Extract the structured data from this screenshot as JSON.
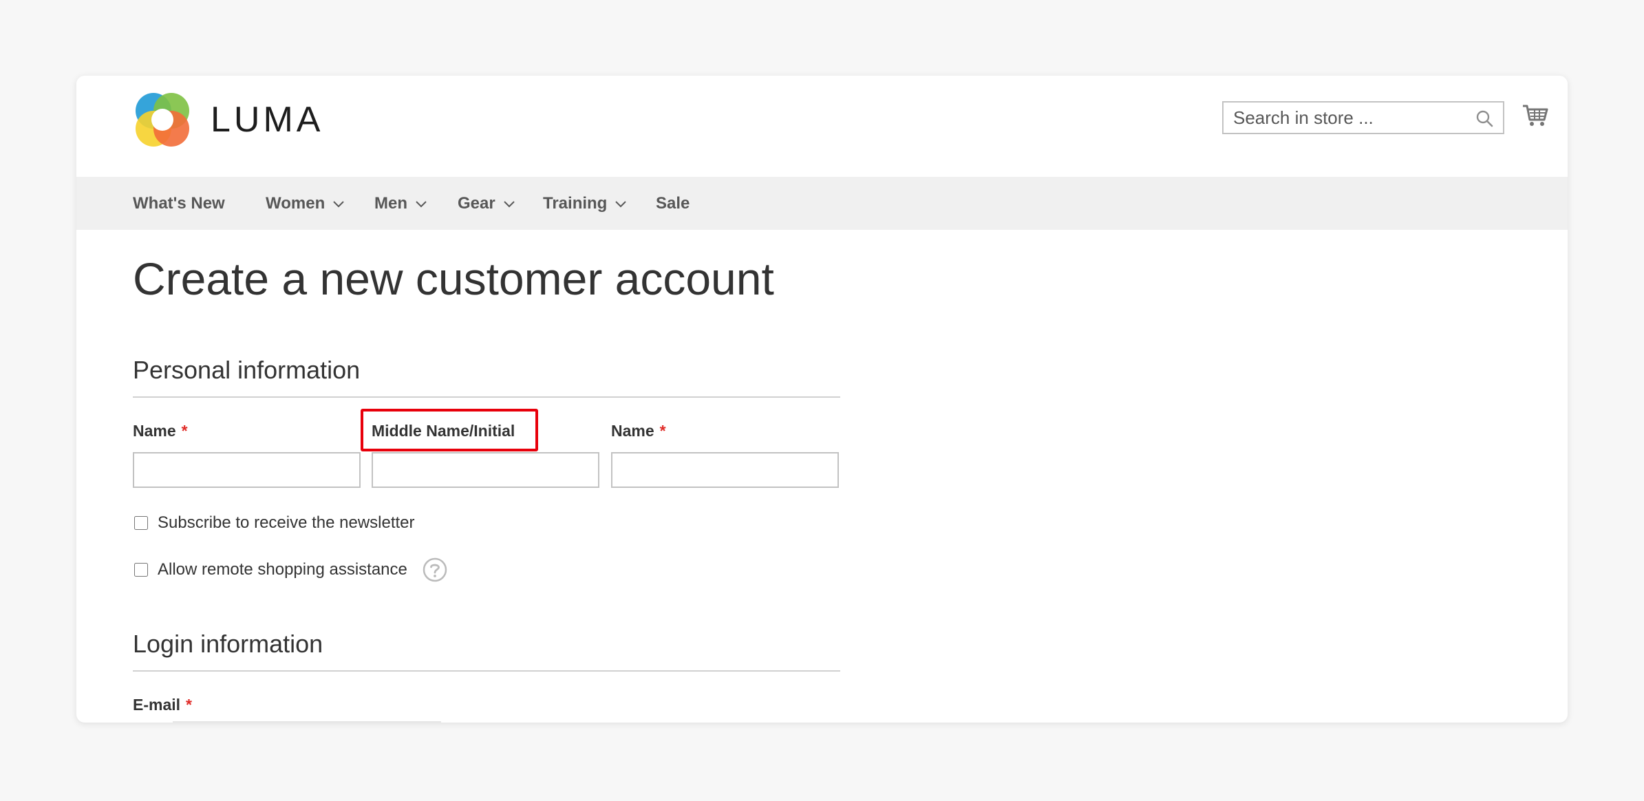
{
  "header": {
    "logo_text": "LUMA",
    "search_placeholder": "Search in store ..."
  },
  "nav": [
    {
      "label": "What's New",
      "has_dropdown": false
    },
    {
      "label": "Women",
      "has_dropdown": true
    },
    {
      "label": "Men",
      "has_dropdown": true
    },
    {
      "label": "Gear",
      "has_dropdown": true
    },
    {
      "label": "Training",
      "has_dropdown": true
    },
    {
      "label": "Sale",
      "has_dropdown": false
    }
  ],
  "page": {
    "title": "Create a new customer account"
  },
  "personal": {
    "section_title": "Personal information",
    "first_name_label": "Name",
    "middle_name_label": "Middle Name/Initial",
    "last_name_label": "Name",
    "required_mark": "*",
    "newsletter_label": "Subscribe to receive the newsletter",
    "remote_assist_label": "Allow remote shopping assistance"
  },
  "login": {
    "section_title": "Login information",
    "email_label": "E-mail",
    "required_mark": "*"
  },
  "colors": {
    "required": "#e02b27",
    "highlight": "#e8000b",
    "nav_bg": "#f0f0f0"
  },
  "icons": {
    "search": "search-icon",
    "cart": "cart-icon",
    "help": "question-circle-icon",
    "dropdown": "chevron-down-icon"
  }
}
